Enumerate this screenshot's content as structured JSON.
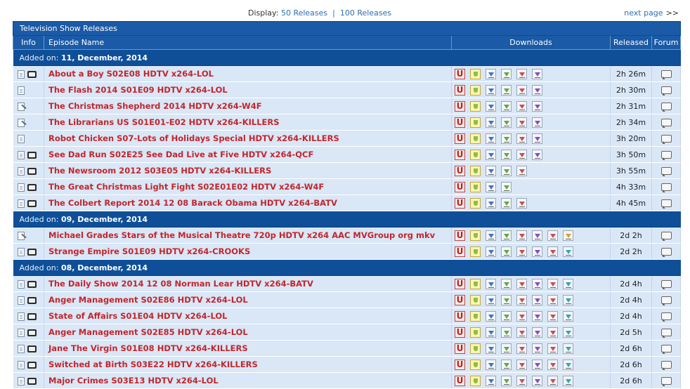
{
  "topbar": {
    "display_label": "Display:",
    "option_50": "50 Releases",
    "separator": "|",
    "option_100": "100 Releases",
    "next_page": "next page",
    "next_arrows": ">>"
  },
  "table": {
    "title": "Television Show Releases",
    "headers": {
      "info": "Info",
      "episode": "Episode Name",
      "downloads": "Downloads",
      "released": "Released",
      "forum": "Forum"
    }
  },
  "groups": [
    {
      "label": "Added on:",
      "date": "11, December, 2014",
      "rows": [
        {
          "info": [
            "doc",
            "tv"
          ],
          "name": "About a Boy S02E08 HDTV x264-LOL",
          "downloads": [
            "bl",
            "gr",
            "rd",
            "pu"
          ],
          "released": "2h 26m"
        },
        {
          "info": [
            "doc"
          ],
          "name": "The Flash 2014 S01E09 HDTV x264-LOL",
          "downloads": [
            "bl",
            "gr",
            "rd",
            "pu"
          ],
          "released": "2h 30m"
        },
        {
          "info": [
            "docpen"
          ],
          "name": "The Christmas Shepherd 2014 HDTV x264-W4F",
          "downloads": [
            "bl",
            "gr",
            "rd",
            "pu"
          ],
          "released": "2h 31m"
        },
        {
          "info": [
            "docpen"
          ],
          "name": "The Librarians US S01E01-E02 HDTV x264-KILLERS",
          "downloads": [
            "bl",
            "gr",
            "rd",
            "pu"
          ],
          "released": "2h 34m"
        },
        {
          "info": [
            "doc"
          ],
          "name": "Robot Chicken S07-Lots of Holidays Special HDTV x264-KILLERS",
          "downloads": [
            "bl",
            "gr",
            "rd",
            "pu"
          ],
          "released": "3h 20m"
        },
        {
          "info": [
            "doc",
            "tv"
          ],
          "name": "See Dad Run S02E25 See Dad Live at Five HDTV x264-QCF",
          "downloads": [
            "bl",
            "gr",
            "rd",
            "pu"
          ],
          "released": "3h 50m"
        },
        {
          "info": [
            "doc",
            "tv"
          ],
          "name": "The Newsroom 2012 S03E05 HDTV x264-KILLERS",
          "downloads": [
            "bl",
            "gr",
            "rd"
          ],
          "released": "3h 55m"
        },
        {
          "info": [
            "doc",
            "tv"
          ],
          "name": "The Great Christmas Light Fight S02E01E02 HDTV x264-W4F",
          "downloads": [
            "bl",
            "gr"
          ],
          "released": "4h 33m"
        },
        {
          "info": [
            "doc",
            "tv"
          ],
          "name": "The Colbert Report 2014 12 08 Barack Obama HDTV x264-BATV",
          "downloads": [
            "bl",
            "gr",
            "rd"
          ],
          "released": "4h 45m"
        }
      ]
    },
    {
      "label": "Added on:",
      "date": "09, December, 2014",
      "rows": [
        {
          "info": [
            "docpen"
          ],
          "name": "Michael Grades Stars of the Musical Theatre 720p HDTV x264 AAC MVGroup org mkv",
          "downloads": [
            "bl",
            "gr",
            "rd",
            "pu",
            "rd",
            "ye"
          ],
          "released": "2d 2h"
        },
        {
          "info": [
            "doc",
            "tv"
          ],
          "name": "Strange Empire S01E09 HDTV x264-CROOKS",
          "downloads": [
            "bl",
            "gr",
            "rd",
            "pu",
            "rd",
            "tq"
          ],
          "released": "2d 2h"
        }
      ]
    },
    {
      "label": "Added on:",
      "date": "08, December, 2014",
      "rows": [
        {
          "info": [
            "doc",
            "tv"
          ],
          "name": "The Daily Show 2014 12 08 Norman Lear HDTV x264-BATV",
          "downloads": [
            "bl",
            "gr",
            "rd",
            "pu",
            "rd",
            "tq"
          ],
          "released": "2d 4h"
        },
        {
          "info": [
            "doc",
            "tv"
          ],
          "name": "Anger Management S02E86 HDTV x264-LOL",
          "downloads": [
            "bl",
            "gr",
            "rd",
            "pu",
            "rd",
            "tq"
          ],
          "released": "2d 4h"
        },
        {
          "info": [
            "doc",
            "tv"
          ],
          "name": "State of Affairs S01E04 HDTV x264-LOL",
          "downloads": [
            "bl",
            "gr",
            "rd",
            "pu",
            "rd",
            "tq"
          ],
          "released": "2d 4h"
        },
        {
          "info": [
            "doc",
            "tv"
          ],
          "name": "Anger Management S02E85 HDTV x264-LOL",
          "downloads": [
            "bl",
            "gr",
            "rd",
            "pu",
            "rd",
            "tq"
          ],
          "released": "2d 5h"
        },
        {
          "info": [
            "doc",
            "tv"
          ],
          "name": "Jane The Virgin S01E08 HDTV x264-KILLERS",
          "downloads": [
            "bl",
            "gr",
            "rd",
            "pu",
            "rd",
            "tq"
          ],
          "released": "2d 6h"
        },
        {
          "info": [
            "doc",
            "tv"
          ],
          "name": "Switched at Birth S03E22 HDTV x264-KILLERS",
          "downloads": [
            "bl",
            "gr",
            "rd",
            "pu",
            "rd",
            "tq"
          ],
          "released": "2d 6h"
        },
        {
          "info": [
            "doc",
            "tv"
          ],
          "name": "Major Crimes S03E13 HDTV x264-LOL",
          "downloads": [
            "bl",
            "gr",
            "rd",
            "pu",
            "rd",
            "tq"
          ],
          "released": "2d 6h"
        }
      ]
    }
  ],
  "colors": {
    "header_blue": "#1a5aa6",
    "date_blue": "#0f4f98",
    "row_bg": "#d9e7f7",
    "link_red": "#c4262b",
    "link_blue": "#2b6fb3"
  }
}
